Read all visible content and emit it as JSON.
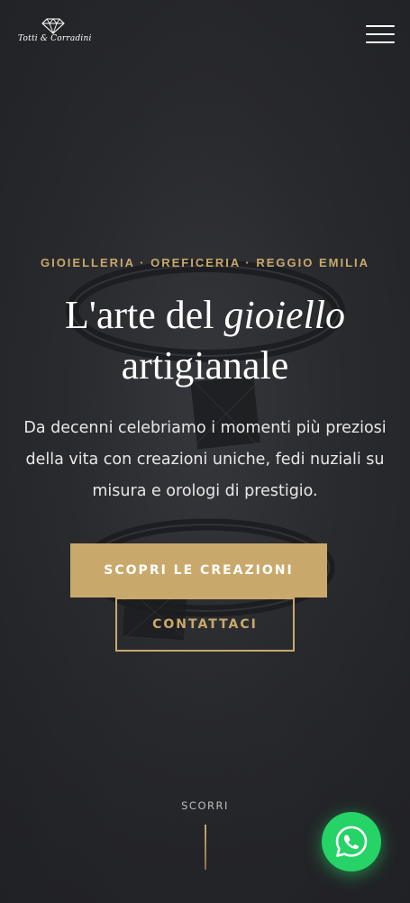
{
  "brand": {
    "name": "Totti & Corradini",
    "logo_icon": "diamond-icon"
  },
  "header": {
    "menu_icon": "hamburger-menu-icon"
  },
  "hero": {
    "eyebrow": "GIOIELLERIA · OREFICERIA · REGGIO EMILIA",
    "headline_part1": "L'arte del",
    "headline_italic": "gioiello",
    "headline_part2": "artigianale",
    "subtitle": "Da decenni celebriamo i momenti più preziosi della vita con creazioni uniche, fedi nuziali su misura e orologi di prestigio.",
    "primary_cta": "SCOPRI LE CREAZIONI",
    "secondary_cta": "CONTATTACI"
  },
  "scroll": {
    "label": "SCORRI"
  },
  "whatsapp": {
    "icon": "whatsapp-icon"
  },
  "colors": {
    "accent_gold": "#c9a96b",
    "background": "#2c2d31",
    "whatsapp_green": "#25d366",
    "text_white": "#ffffff"
  }
}
